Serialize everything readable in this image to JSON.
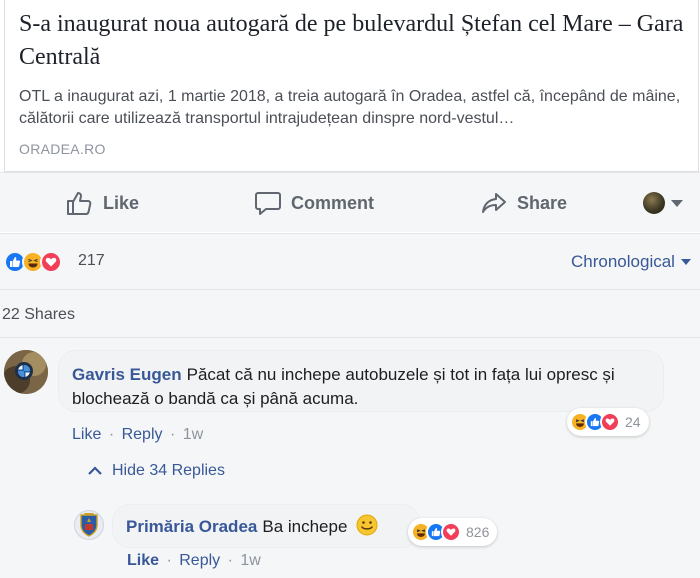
{
  "link_preview": {
    "title": "S-a inaugurat noua autogară de pe bulevardul Ștefan cel Mare – Gara Centrală",
    "description": "OTL a inaugurat azi, 1 martie 2018, a treia autogară în Oradea, astfel că, începând de mâine, călătorii care utilizează transportul intrajudețean dinspre nord-vestul…",
    "domain": "ORADEA.RO"
  },
  "actions": {
    "like_label": "Like",
    "comment_label": "Comment",
    "share_label": "Share",
    "icons": [
      "thumbs-up-icon",
      "comment-bubble-icon",
      "share-arrow-icon",
      "chevron-down-icon"
    ]
  },
  "reactions": {
    "types": [
      "like",
      "haha",
      "love"
    ],
    "count": "217",
    "sort_selected": "Chronological"
  },
  "shares": {
    "text": "22 Shares"
  },
  "comments": [
    {
      "author": "Gavris Eugen",
      "text": "Păcat că nu inchepe autobuzele și tot in fața lui opresc și blochează o bandă ca și până acuma.",
      "reactions": [
        "haha",
        "like",
        "love"
      ],
      "reaction_count": "24",
      "like_label": "Like",
      "reply_label": "Reply",
      "time": "1w",
      "hide_replies_label": "Hide 34 Replies"
    }
  ],
  "replies": [
    {
      "author": "Primăria Oradea",
      "text": "Ba inchepe",
      "emoji": "smiley-face-icon",
      "reactions": [
        "haha",
        "like",
        "love"
      ],
      "reaction_count": "826",
      "like_label": "Like",
      "reply_label": "Reply",
      "time": "1w"
    }
  ],
  "colors": {
    "link_blue": "#385898",
    "like_blue": "#1877f2",
    "haha_yellow": "#f7b125",
    "love_red": "#f33e58",
    "muted_text": "#8d949e"
  }
}
